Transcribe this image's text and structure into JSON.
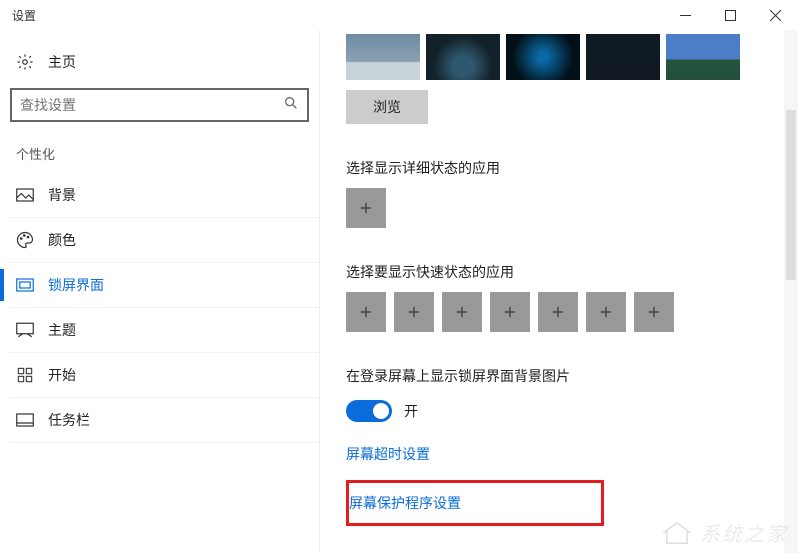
{
  "window": {
    "title": "设置"
  },
  "sidebar": {
    "home": "主页",
    "search_placeholder": "查找设置",
    "section": "个性化",
    "items": [
      {
        "label": "背景"
      },
      {
        "label": "颜色"
      },
      {
        "label": "锁屏界面"
      },
      {
        "label": "主题"
      },
      {
        "label": "开始"
      },
      {
        "label": "任务栏"
      }
    ]
  },
  "main": {
    "browse": "浏览",
    "detail_label": "选择显示详细状态的应用",
    "quick_label": "选择要显示快速状态的应用",
    "signin_label": "在登录屏幕上显示锁屏界面背景图片",
    "toggle_state": "开",
    "timeout_link": "屏幕超时设置",
    "screensaver_link": "屏幕保护程序设置"
  },
  "watermark": "系统之家"
}
